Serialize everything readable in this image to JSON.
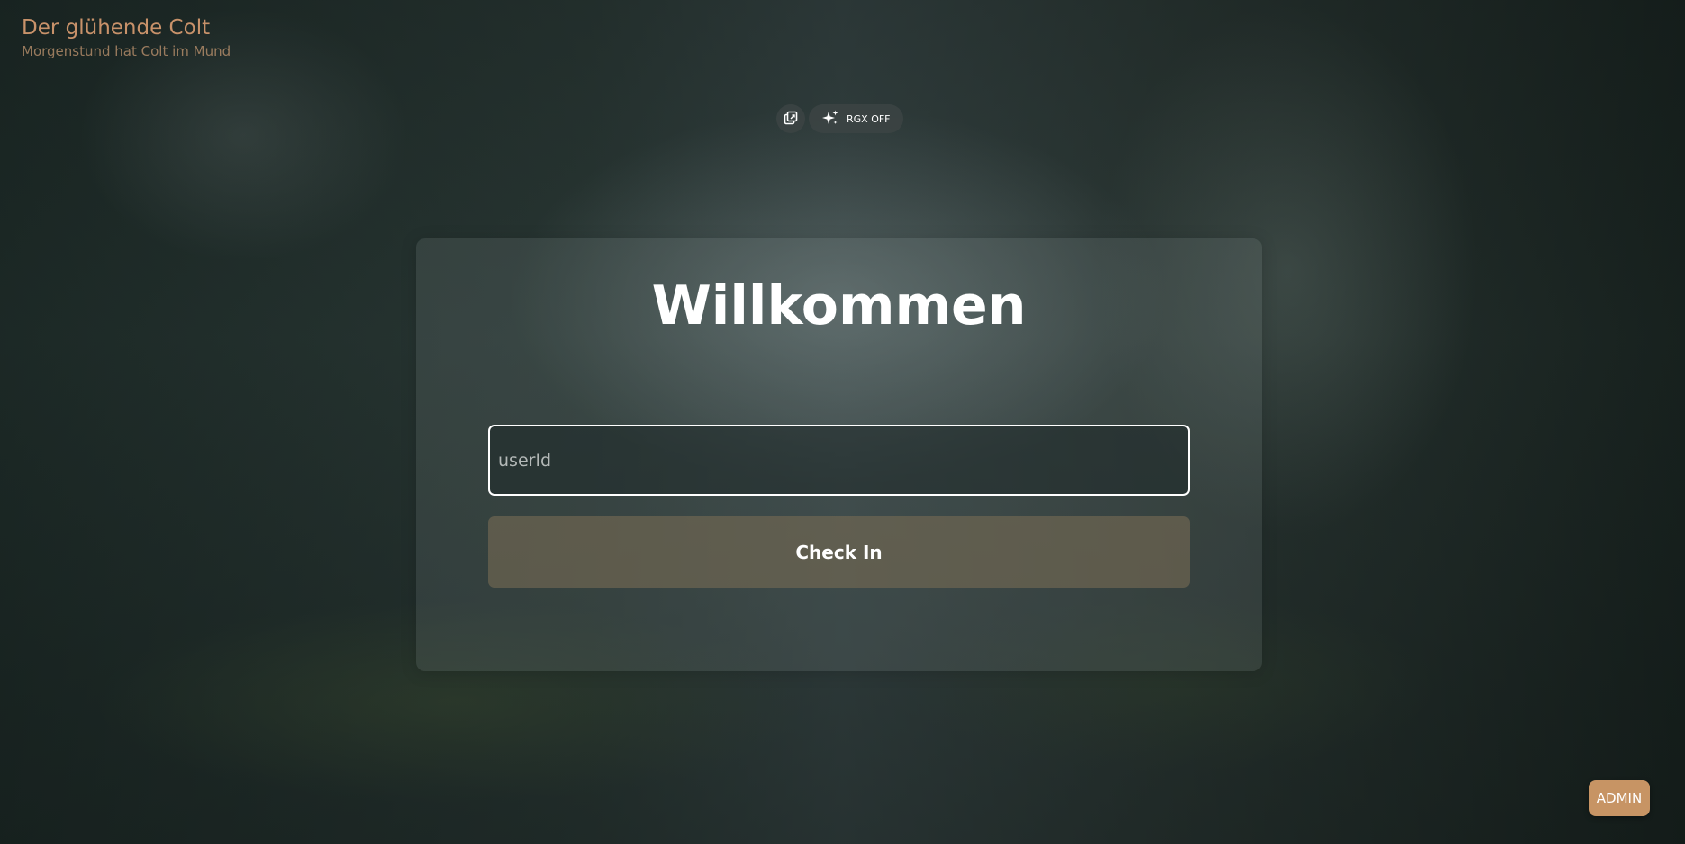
{
  "header": {
    "title": "Der glühende Colt",
    "subtitle": "Morgenstund hat Colt im Mund"
  },
  "toolbar": {
    "copy_icon": "copy-window-icon",
    "rgx_icon": "sparkles-icon",
    "rgx_label": "RGX OFF"
  },
  "login": {
    "heading": "Willkommen",
    "user_placeholder": "userId",
    "user_value": "",
    "submit_label": "Check In"
  },
  "admin": {
    "label": "ADMIN"
  },
  "colors": {
    "accent": "#c79464",
    "brand_text": "#c8926a",
    "button_bg": "#766a54"
  }
}
